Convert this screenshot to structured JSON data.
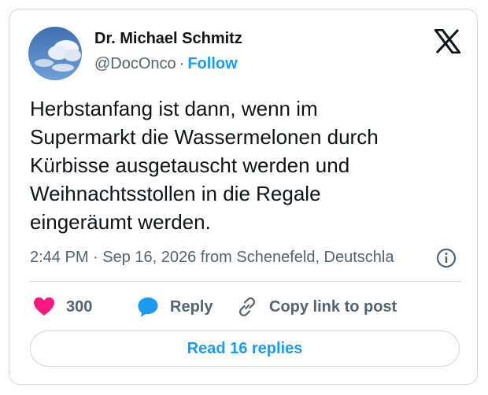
{
  "author": {
    "name": "Dr. Michael Schmitz",
    "handle": "@DocOnco",
    "separator": "·",
    "follow_label": "Follow"
  },
  "brand": {
    "logo_icon": "x-logo-icon"
  },
  "tweet": {
    "text": "Herbstanfang ist dann, wenn im\nSupermarkt die Wassermelonen durch\nKürbisse ausgetauscht werden und\nWeihnachtsstollen in die Regale\neingeräumt werden."
  },
  "meta": {
    "text": "2:44 PM · Sep 16, 2026 from Schenefeld, Deutschla",
    "info_icon": "info-icon"
  },
  "actions": {
    "like_count": "300",
    "like_icon": "heart-icon",
    "reply_label": "Reply",
    "reply_icon": "speech-bubble-icon",
    "copy_label": "Copy link to post",
    "copy_icon": "link-icon"
  },
  "footer": {
    "read_replies_label": "Read 16 replies"
  },
  "colors": {
    "accent": "#1d9bf0",
    "heart": "#f91880",
    "muted_text": "#536471",
    "border": "#cfd9de"
  }
}
